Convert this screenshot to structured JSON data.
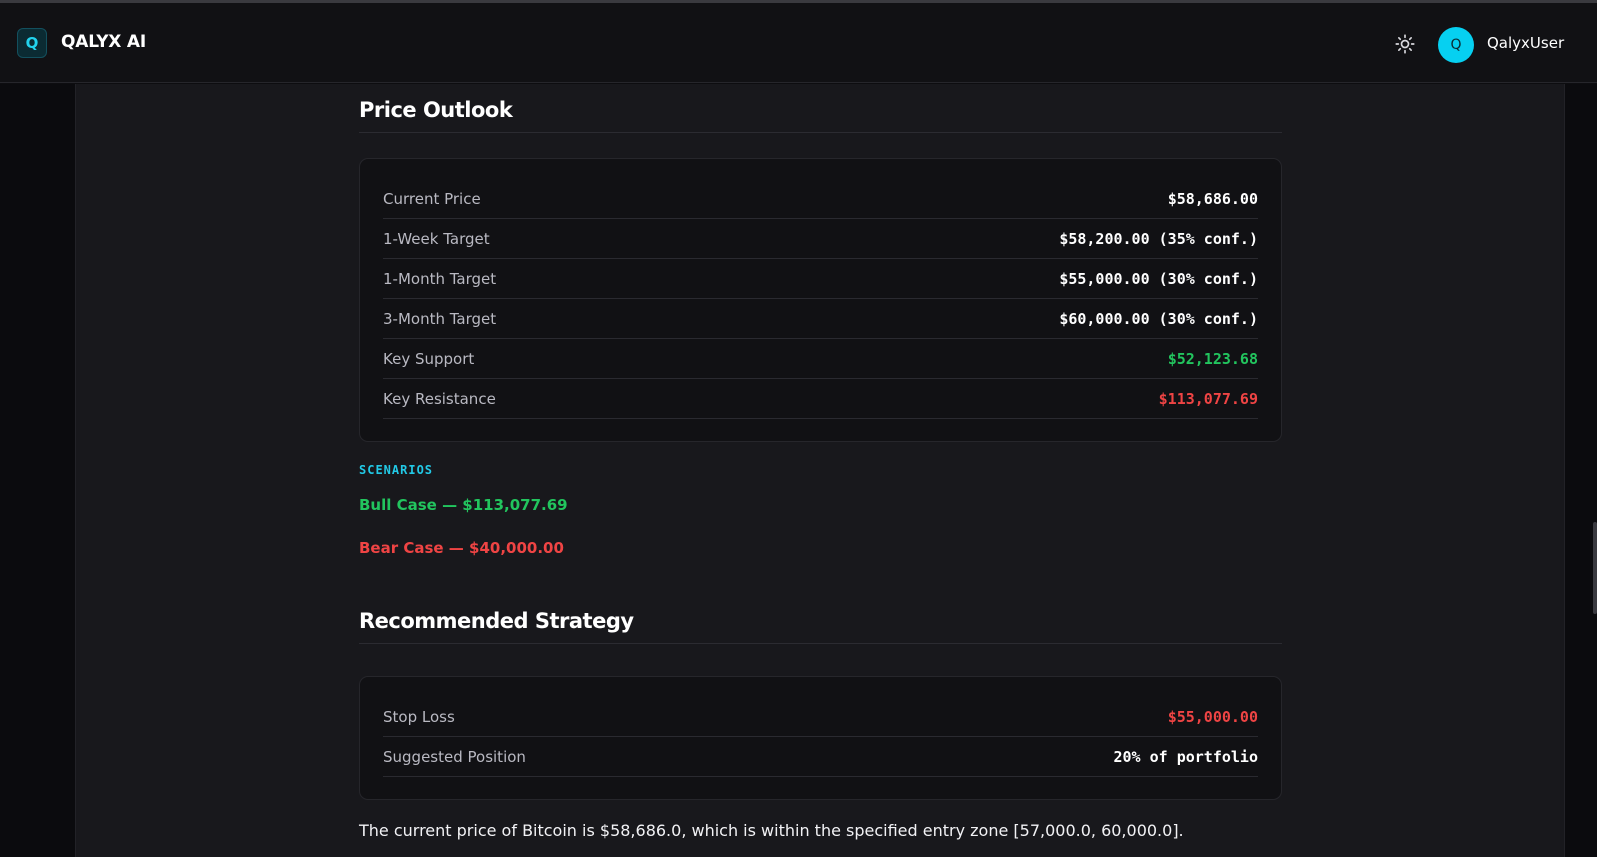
{
  "header": {
    "logo_letter": "Q",
    "brand": "QALYX AI",
    "theme_icon": "sun-icon",
    "avatar_letter": "Q",
    "username": "QalyxUser"
  },
  "price_outlook": {
    "title": "Price Outlook",
    "rows": [
      {
        "label": "Current Price",
        "value": "$58,686.00",
        "tone": "default"
      },
      {
        "label": "1-Week Target",
        "value": "$58,200.00 (35% conf.)",
        "tone": "default"
      },
      {
        "label": "1-Month Target",
        "value": "$55,000.00 (30% conf.)",
        "tone": "default"
      },
      {
        "label": "3-Month Target",
        "value": "$60,000.00 (30% conf.)",
        "tone": "default"
      },
      {
        "label": "Key Support",
        "value": "$52,123.68",
        "tone": "green"
      },
      {
        "label": "Key Resistance",
        "value": "$113,077.69",
        "tone": "red"
      }
    ]
  },
  "scenarios": {
    "label": "SCENARIOS",
    "bull": "Bull Case — $113,077.69",
    "bear": "Bear Case — $40,000.00"
  },
  "strategy": {
    "title": "Recommended Strategy",
    "rows": [
      {
        "label": "Stop Loss",
        "value": "$55,000.00",
        "tone": "red"
      },
      {
        "label": "Suggested Position",
        "value": "20% of portfolio",
        "tone": "default"
      }
    ]
  },
  "summary": "The current price of Bitcoin is $58,686.0, which is within the specified entry zone [57,000.0, 60,000.0].",
  "colors": {
    "accent": "#22d3ee",
    "positive": "#22c55e",
    "negative": "#ef4444"
  }
}
